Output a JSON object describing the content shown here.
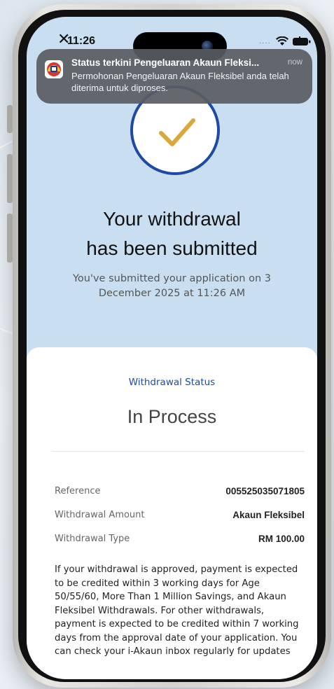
{
  "status_bar": {
    "close_glyph": "✕",
    "time": "11:26",
    "signal_dots": "....",
    "wifi_icon": "wifi-icon",
    "battery_icon": "battery-icon"
  },
  "notification": {
    "title": "Status terkini Pengeluaran Akaun Fleksi...",
    "time": "now",
    "body": "Permohonan Pengeluaran Akaun Fleksibel anda telah diterima untuk diproses.",
    "app_icon": "kwsp-logo-icon"
  },
  "hero": {
    "icon": "checkmark-icon",
    "headline_line1": "Your withdrawal",
    "headline_line2": "has been submitted",
    "subtitle": "You've submitted your application on 3 December 2025 at 11:26 AM"
  },
  "card": {
    "status_label": "Withdrawal Status",
    "status_value": "In Process",
    "rows": [
      {
        "label": "Reference",
        "value": "005525035071805"
      },
      {
        "label": "Withdrawal Amount",
        "value": "Akaun Fleksibel"
      },
      {
        "label": "Withdrawal Type",
        "value": "RM 100.00"
      }
    ],
    "note": "If your withdrawal is approved, payment is expected to be credited within 3 working days for Age 50/55/60, More Than 1 Million Savings, and Akaun Fleksibel Withdrawals. For other withdrawals, payment is expected to be credited within 7 working days from the approval date of your application. You can check your i-Akaun inbox regularly for updates"
  },
  "colors": {
    "screen_bg": "#c9dff1",
    "accent_blue": "#1f4aa3",
    "check_gold": "#d9a83a",
    "notification_bg": "#585c62"
  }
}
